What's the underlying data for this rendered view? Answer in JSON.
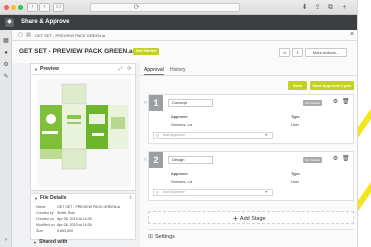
{
  "app": {
    "name": "Share & Approve"
  },
  "breadcrumb": {
    "path": "GET SET - PREVIEW PACK GREEN ai"
  },
  "page": {
    "title": "GET SET - PREVIEW PACK GREEN.ai",
    "status_badge": "Not Started",
    "more_actions": "More Actions..."
  },
  "preview": {
    "header": "Preview"
  },
  "file_details": {
    "header": "File Details",
    "rows": [
      {
        "key": "Name",
        "value": "GET SET - PREVIEW PACK GREEN.ai"
      },
      {
        "key": "Created by",
        "value": "Smith, Bob"
      },
      {
        "key": "Created on",
        "value": "Apr 08, 2019 at 14:35"
      },
      {
        "key": "Modified on",
        "value": "Apr 08, 2019 at 14:35"
      },
      {
        "key": "Size",
        "value": "5,653,500"
      }
    ]
  },
  "shared_with": {
    "header": "Shared with"
  },
  "tabs": [
    {
      "label": "Approval",
      "active": true
    },
    {
      "label": "History",
      "active": false
    }
  ],
  "actions": {
    "save": "Save",
    "start_cycle": "Start Approval Cycle"
  },
  "stages": [
    {
      "number": "1",
      "name": "Concept",
      "status": "Not Started",
      "col_approver": "Approver",
      "col_type": "Type",
      "approver": "Greaves, Liz",
      "type": "User",
      "add_placeholder": "Add Approver"
    },
    {
      "number": "2",
      "name": "Design",
      "status": "Not Started",
      "col_approver": "Approver",
      "col_type": "Type",
      "approver": "Greaves, Liz",
      "type": "User",
      "add_placeholder": "Add Approver"
    }
  ],
  "add_stage": "Add Stage",
  "settings": "Settings",
  "colors": {
    "accent": "#c3d21a",
    "header_bg": "#3b3f42",
    "stripe": "#f2e51a"
  }
}
